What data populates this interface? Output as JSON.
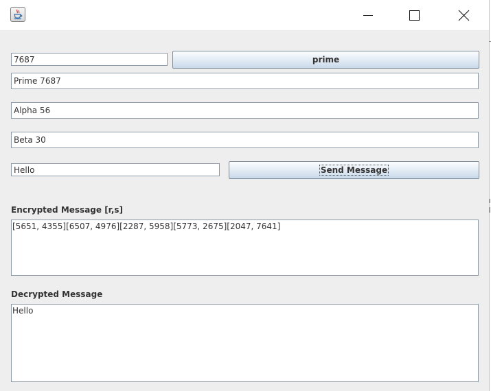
{
  "window": {
    "icon": "java-cup-icon",
    "controls": {
      "minimize_icon": "minimize-icon",
      "maximize_icon": "maximize-icon",
      "close_icon": "close-icon"
    }
  },
  "form": {
    "number_input": "7687",
    "prime_button": "prime",
    "prime_field": "Prime 7687",
    "alpha_field": "Alpha 56",
    "beta_field": "Beta 30",
    "message_input": "Hello",
    "send_button": "Send Message"
  },
  "encrypted": {
    "label": "Encrypted Message [r,s]",
    "text": "[5651, 4355][6507, 4976][2287, 5958][5773, 2675][2047, 7641]"
  },
  "decrypted": {
    "label": "Decrypted Message",
    "text": "Hello"
  },
  "colors": {
    "window_bg": "#eeeeee",
    "titlebar_bg": "#ffffff",
    "field_border": "#8e9aa8",
    "button_gradient_top": "#fbfdff",
    "button_gradient_bottom": "#c9d9ea"
  }
}
